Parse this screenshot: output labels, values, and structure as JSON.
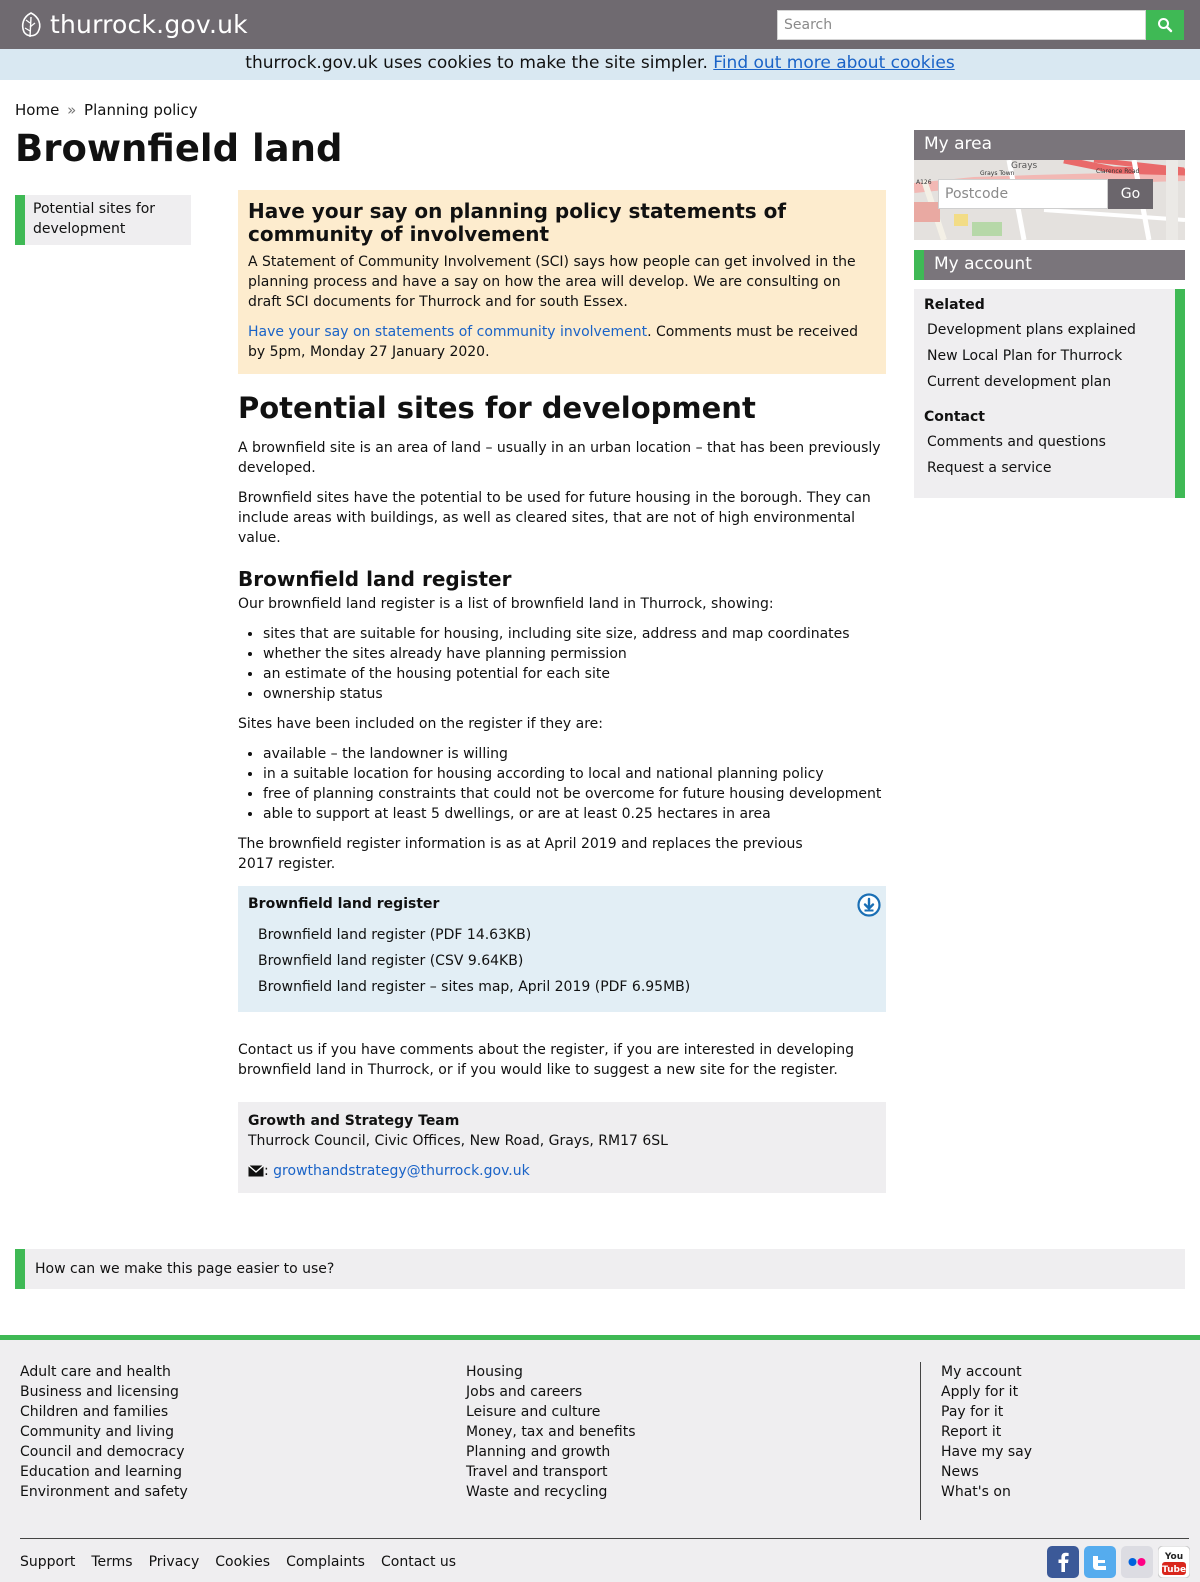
{
  "header": {
    "logo_text": "thurrock.gov.uk",
    "search_placeholder": "Search"
  },
  "cookie_bar": {
    "text": "thurrock.gov.uk uses cookies to make the site simpler. ",
    "link": "Find out more about cookies"
  },
  "breadcrumb": {
    "home": "Home",
    "separator": "»",
    "current": "Planning policy"
  },
  "page_title": "Brownfield land",
  "left_nav": {
    "item": "Potential sites for development"
  },
  "notice": {
    "title": "Have your say on planning policy statements of community of involvement",
    "body": "A Statement of Community Involvement (SCI) says how people can get involved in the planning process and have a say on how the area will develop. We are consulting on draft SCI documents for Thurrock and for south Essex.",
    "link": "Have your say on statements of community involvement",
    "after_link": ". Comments must be received by 5pm, Monday 27 January 2020."
  },
  "main": {
    "heading": "Potential sites for development",
    "intro1": "A brownfield site is an area of land – usually in an urban location – that has been previously developed.",
    "intro2": "Brownfield sites have the potential to be used for future housing in the borough. They can include areas with buildings, as well as cleared sites, that are not of high environmental value.",
    "register_heading": "Brownfield land register",
    "register_intro": "Our brownfield land register is a list of brownfield land in Thurrock, showing:",
    "register_items": [
      "sites that are suitable for housing, including site size, address and map coordinates",
      "whether the sites already have planning permission",
      "an estimate of the housing potential for each site",
      "ownership status"
    ],
    "included_intro": "Sites have been included on the register if they are:",
    "included_items": [
      "available – the landowner is willing",
      "in a suitable location for housing according to local and national planning policy",
      "free of planning constraints that could not be overcome for future housing development",
      "able to support at least 5 dwellings, or are at least 0.25 hectares in area"
    ],
    "date_note": "The brownfield register information is as at April 2019 and replaces the previous 2017 register."
  },
  "downloads": {
    "title": "Brownfield land register",
    "items": [
      "Brownfield land register (PDF 14.63KB)",
      "Brownfield land register (CSV 9.64KB)",
      "Brownfield land register – sites map, April 2019 (PDF 6.95MB)"
    ]
  },
  "contact_text": "Contact us if you have comments about the register, if you are interested in developing brownfield land in Thurrock, or if you would like to suggest a new site for the register.",
  "contact_box": {
    "team": "Growth and Strategy Team",
    "address": "Thurrock Council, Civic Offices, New Road, Grays, RM17 6SL",
    "email_sep": ":",
    "email": "growthandstrategy@thurrock.gov.uk"
  },
  "sidebar": {
    "my_area": "My area",
    "postcode_placeholder": "Postcode",
    "go": "Go",
    "map_labels": [
      "Grays",
      "Grays Town",
      "Clarence Road",
      "A126"
    ],
    "my_account": "My account",
    "related_title": "Related",
    "related_links": [
      "Development plans explained",
      "New Local Plan for Thurrock",
      "Current development plan"
    ],
    "contact_title": "Contact",
    "contact_links": [
      "Comments and questions",
      "Request a service"
    ]
  },
  "feedback": "How can we make this page easier to use?",
  "footer": {
    "col1": [
      "Adult care and health",
      "Business and licensing",
      "Children and families",
      "Community and living",
      "Council and democracy",
      "Education and learning",
      "Environment and safety"
    ],
    "col2": [
      "Housing",
      "Jobs and careers",
      "Leisure and culture",
      "Money, tax and benefits",
      "Planning and growth",
      "Travel and transport",
      "Waste and recycling"
    ],
    "col3": [
      "My account",
      "Apply for it",
      "Pay for it",
      "Report it",
      "Have my say",
      "News",
      "What's on"
    ],
    "bottom_links": [
      "Support",
      "Terms",
      "Privacy",
      "Cookies",
      "Complaints",
      "Contact us"
    ],
    "social_icons": [
      "facebook-icon",
      "twitter-icon",
      "flickr-icon",
      "youtube-icon"
    ]
  },
  "colors": {
    "header_bg": "#6f6a70",
    "accent_green": "#3fb955",
    "link_blue": "#1a63c7",
    "notice_bg": "#fdecce",
    "download_bg": "#e2eef5"
  }
}
